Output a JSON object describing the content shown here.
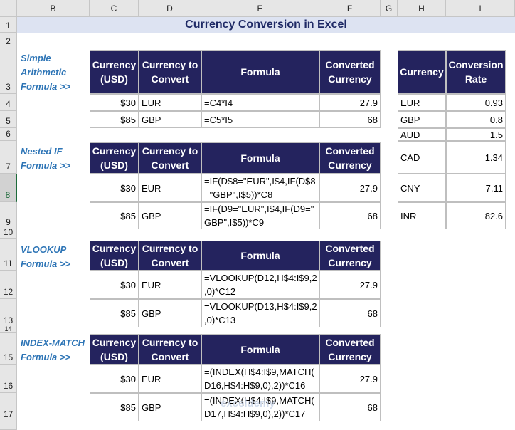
{
  "columns": [
    "B",
    "C",
    "D",
    "E",
    "F",
    "G",
    "H",
    "I"
  ],
  "rows": [
    "1",
    "2",
    "3",
    "4",
    "5",
    "6",
    "7",
    "8",
    "9",
    "10",
    "11",
    "12",
    "13",
    "14",
    "15",
    "16",
    "17"
  ],
  "title": "Currency Conversion in Excel",
  "headers": {
    "currency_usd": "Currency\n(USD)",
    "currency_to_convert": "Currency to\nConvert",
    "formula": "Formula",
    "converted": "Converted\nCurrency",
    "currency": "Currency",
    "conversion_rate": "Conversion\nRate"
  },
  "sections": [
    {
      "label": "Simple\nArithmetic\nFormula >>",
      "rows": [
        {
          "amount": "$30",
          "currency": "EUR",
          "formula": "=C4*I4",
          "converted": "27.9"
        },
        {
          "amount": "$85",
          "currency": "GBP",
          "formula": "=C5*I5",
          "converted": "68"
        }
      ]
    },
    {
      "label": "Nested IF\nFormula >>",
      "rows": [
        {
          "amount": "$30",
          "currency": "EUR",
          "formula": "=IF(D$8=\"EUR\",I$4,IF(D$8\n=\"GBP\",I$5))*C8",
          "converted": "27.9"
        },
        {
          "amount": "$85",
          "currency": "GBP",
          "formula": "=IF(D9=\"EUR\",I$4,IF(D9=\"\nGBP\",I$5))*C9",
          "converted": "68"
        }
      ]
    },
    {
      "label": "VLOOKUP\nFormula >>",
      "rows": [
        {
          "amount": "$30",
          "currency": "EUR",
          "formula": "=VLOOKUP(D12,H$4:I$9,2\n,0)*C12",
          "converted": "27.9"
        },
        {
          "amount": "$85",
          "currency": "GBP",
          "formula": "=VLOOKUP(D13,H$4:I$9,2\n,0)*C13",
          "converted": "68"
        }
      ]
    },
    {
      "label": "INDEX-MATCH\nFormula >>",
      "rows": [
        {
          "amount": "$30",
          "currency": "EUR",
          "formula": "=(INDEX(H$4:I$9,MATCH(\nD16,H$4:H$9,0),2))*C16",
          "converted": "27.9"
        },
        {
          "amount": "$85",
          "currency": "GBP",
          "formula": "=(INDEX(H$4:I$9,MATCH(\nD17,H$4:H$9,0),2))*C17",
          "converted": "68"
        }
      ]
    }
  ],
  "rates": [
    {
      "currency": "EUR",
      "rate": "0.93"
    },
    {
      "currency": "GBP",
      "rate": "0.8"
    },
    {
      "currency": "AUD",
      "rate": "1.5"
    },
    {
      "currency": "CAD",
      "rate": "1.34"
    },
    {
      "currency": "CNY",
      "rate": "7.11"
    },
    {
      "currency": "INR",
      "rate": "82.6"
    }
  ],
  "watermark": "exceldemy"
}
